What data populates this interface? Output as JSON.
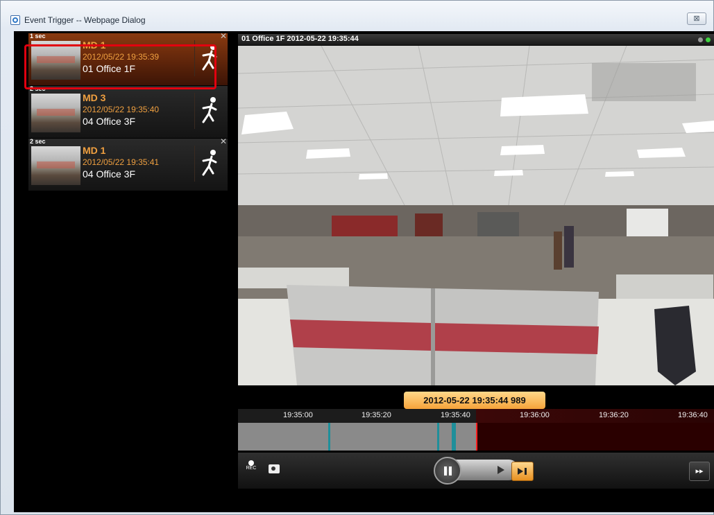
{
  "window": {
    "title": "Event Trigger -- Webpage Dialog",
    "close_label": "⊠"
  },
  "events": [
    {
      "duration": "1 sec",
      "type": "MD 1",
      "timestamp": "2012/05/22 19:35:39",
      "location": "01 Office 1F",
      "selected": true
    },
    {
      "duration": "2 sec",
      "type": "MD 3",
      "timestamp": "2012/05/22 19:35:40",
      "location": "04 Office 3F",
      "selected": false
    },
    {
      "duration": "2 sec",
      "type": "MD 1",
      "timestamp": "2012/05/22 19:35:41",
      "location": "04 Office 3F",
      "selected": false
    }
  ],
  "event_close_label": "✕",
  "video": {
    "title": "01 Office 1F   2012-05-22 19:35:44"
  },
  "timeline": {
    "current": "2012-05-22 19:35:44 989",
    "ticks": [
      "19:35:00",
      "19:35:20",
      "19:35:40",
      "19:36:00",
      "19:36:20",
      "19:36:40"
    ],
    "played_fraction": 0.5
  },
  "controls": {
    "rec_label": "REC",
    "ff_label": "▸▸"
  },
  "colors": {
    "accent": "#f0a040",
    "selection": "#e2000f",
    "status_green": "#3fd33f"
  }
}
